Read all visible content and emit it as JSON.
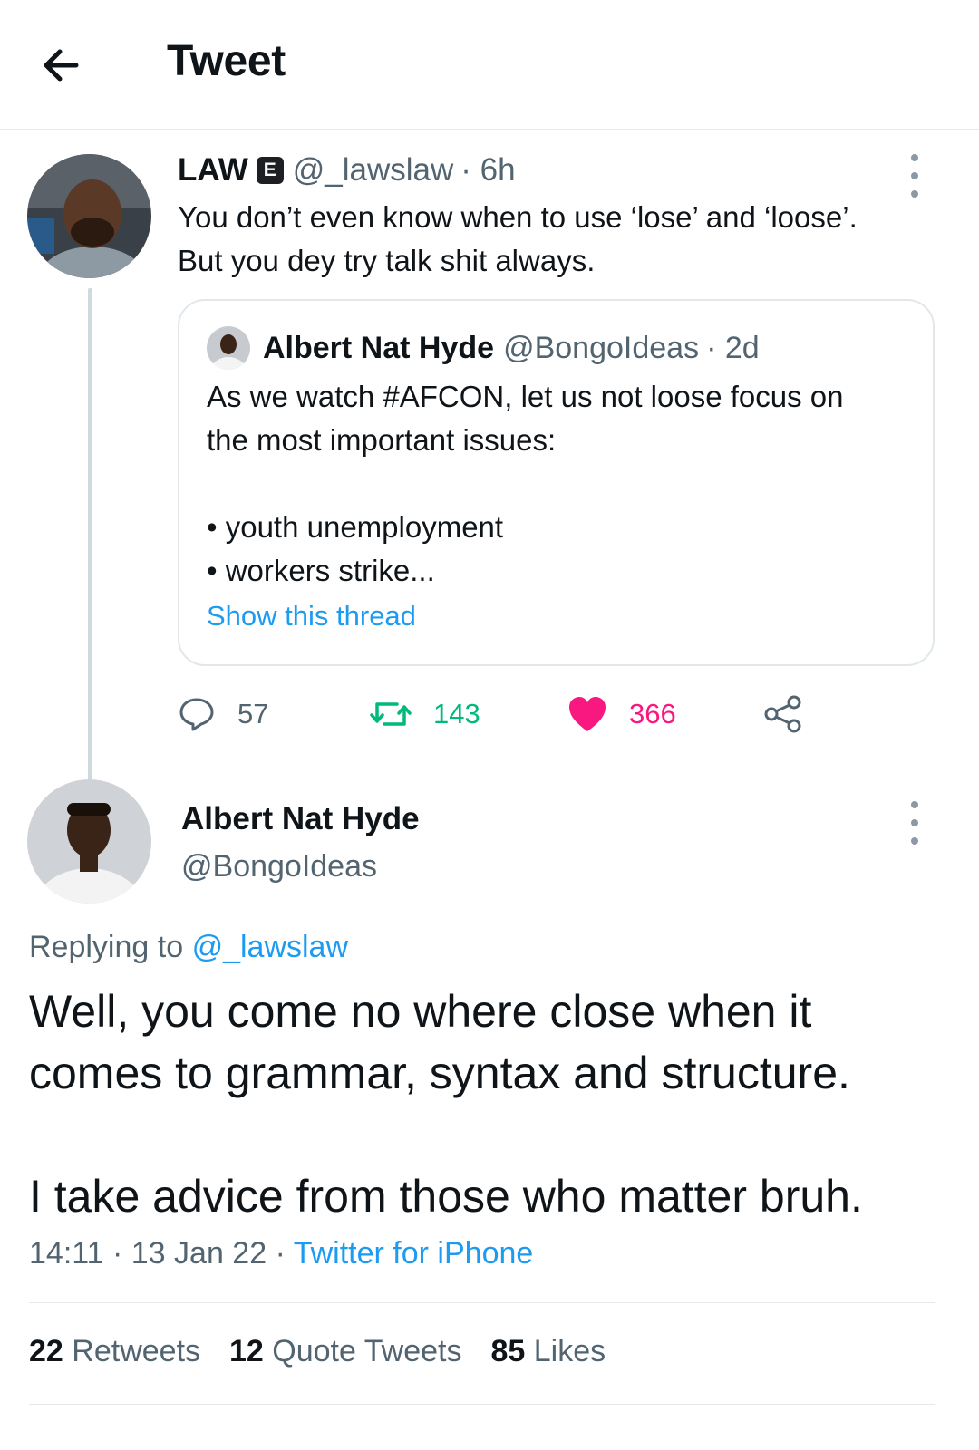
{
  "header": {
    "title": "Tweet",
    "back_icon": "arrow-left-icon"
  },
  "tweet": {
    "author_name": "LAW",
    "badge": "E",
    "handle": "@_lawslaw",
    "time": "· 6h",
    "text_line1": "You don’t even know when to use ‘lose’ and ‘loose’.",
    "text_line2": "But you dey try talk shit always.",
    "quote": {
      "author_name": "Albert Nat Hyde",
      "handle": "@BongoIdeas",
      "time": "· 2d",
      "line1": "As we watch #AFCON, let us not loose focus on",
      "line2": "the most important issues:",
      "bullet1": "• youth unemployment",
      "bullet2": "• workers strike...",
      "show_thread": "Show this thread"
    },
    "actions": {
      "replies": "57",
      "retweets": "143",
      "likes": "366",
      "retweet_color": "#00ba7c",
      "like_color": "#f91880"
    }
  },
  "reply": {
    "author_name": "Albert Nat Hyde",
    "handle": "@BongoIdeas",
    "replying_prefix": "Replying to",
    "replying_handle": "@_lawslaw",
    "text_line1": "Well, you come no where close when it",
    "text_line2": "comes to grammar, syntax and structure.",
    "text_line3": "I take advice from those who matter bruh.",
    "time": "14:11 · 13 Jan 22 ·",
    "source": "Twitter for iPhone",
    "stats": {
      "retweets_count": "22",
      "retweets_label": "Retweets",
      "quotes_count": "12",
      "quotes_label": "Quote Tweets",
      "likes_count": "85",
      "likes_label": "Likes"
    }
  },
  "colors": {
    "accent": "#1d9bf0",
    "text": "#0f1419",
    "muted": "#536471"
  }
}
